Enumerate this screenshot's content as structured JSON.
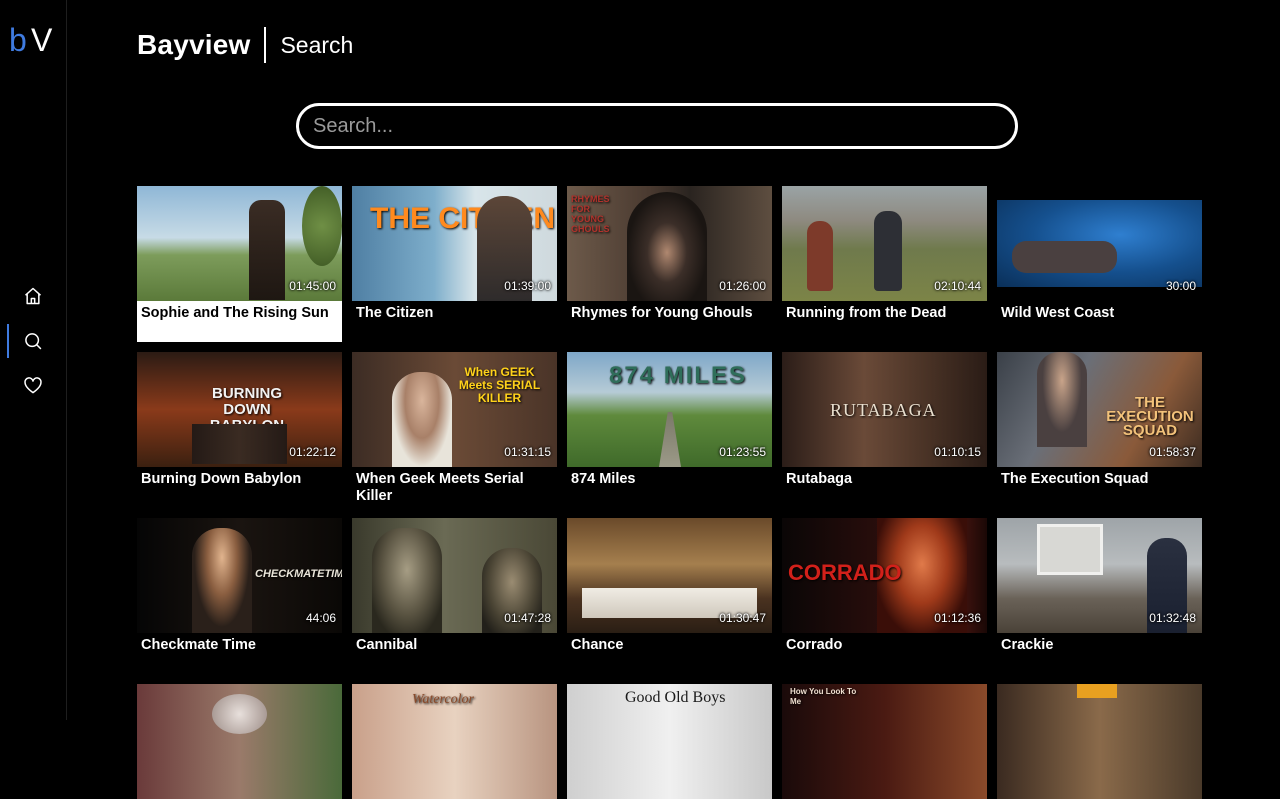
{
  "app": {
    "brand": "Bayview",
    "page_title": "Search",
    "logo_text": "bV"
  },
  "colors": {
    "accent": "#3f7be0",
    "background": "#000000",
    "text": "#ffffff"
  },
  "sidebar": {
    "items": [
      {
        "name": "home",
        "icon": "home-icon",
        "active": false
      },
      {
        "name": "search",
        "icon": "search-icon",
        "active": true
      },
      {
        "name": "favorites",
        "icon": "heart-icon",
        "active": false
      }
    ]
  },
  "search": {
    "placeholder": "Search...",
    "value": ""
  },
  "results": [
    {
      "title": "Sophie and The Rising Sun",
      "duration": "01:45:00",
      "focused": true
    },
    {
      "title": "The Citizen",
      "duration": "01:39:00",
      "art_text": "THE CITIZEN"
    },
    {
      "title": "Rhymes for Young Ghouls",
      "duration": "01:26:00",
      "art_text": "RHYMES FOR YOUNG GHOULS"
    },
    {
      "title": "Running from the Dead",
      "duration": "02:10:44"
    },
    {
      "title": "Wild West Coast",
      "duration": "30:00"
    },
    {
      "title": "Burning Down Babylon",
      "duration": "01:22:12",
      "art_text": "BURNING DOWN BABYLON"
    },
    {
      "title": "When Geek Meets Serial Killer",
      "duration": "01:31:15",
      "art_text": "When GEEK Meets SERIAL KILLER"
    },
    {
      "title": "874 Miles",
      "duration": "01:23:55",
      "art_text": "874 MILES"
    },
    {
      "title": "Rutabaga",
      "duration": "01:10:15",
      "art_text": "RUTABAGA"
    },
    {
      "title": "The Execution Squad",
      "duration": "01:58:37",
      "art_text": "THE EXECUTION SQUAD"
    },
    {
      "title": "Checkmate Time",
      "duration": "44:06",
      "art_text": "CHECKMATETIME"
    },
    {
      "title": "Cannibal",
      "duration": "01:47:28"
    },
    {
      "title": "Chance",
      "duration": "01:30:47"
    },
    {
      "title": "Corrado",
      "duration": "01:12:36",
      "art_text": "CORRADO"
    },
    {
      "title": "Crackie",
      "duration": "01:32:48"
    },
    {
      "title": "",
      "duration": ""
    },
    {
      "title": "",
      "duration": "",
      "art_text": "Watercolor"
    },
    {
      "title": "",
      "duration": "",
      "art_text": "Good Old Boys"
    },
    {
      "title": "",
      "duration": "",
      "art_text": "How You Look To Me"
    },
    {
      "title": "",
      "duration": ""
    }
  ]
}
